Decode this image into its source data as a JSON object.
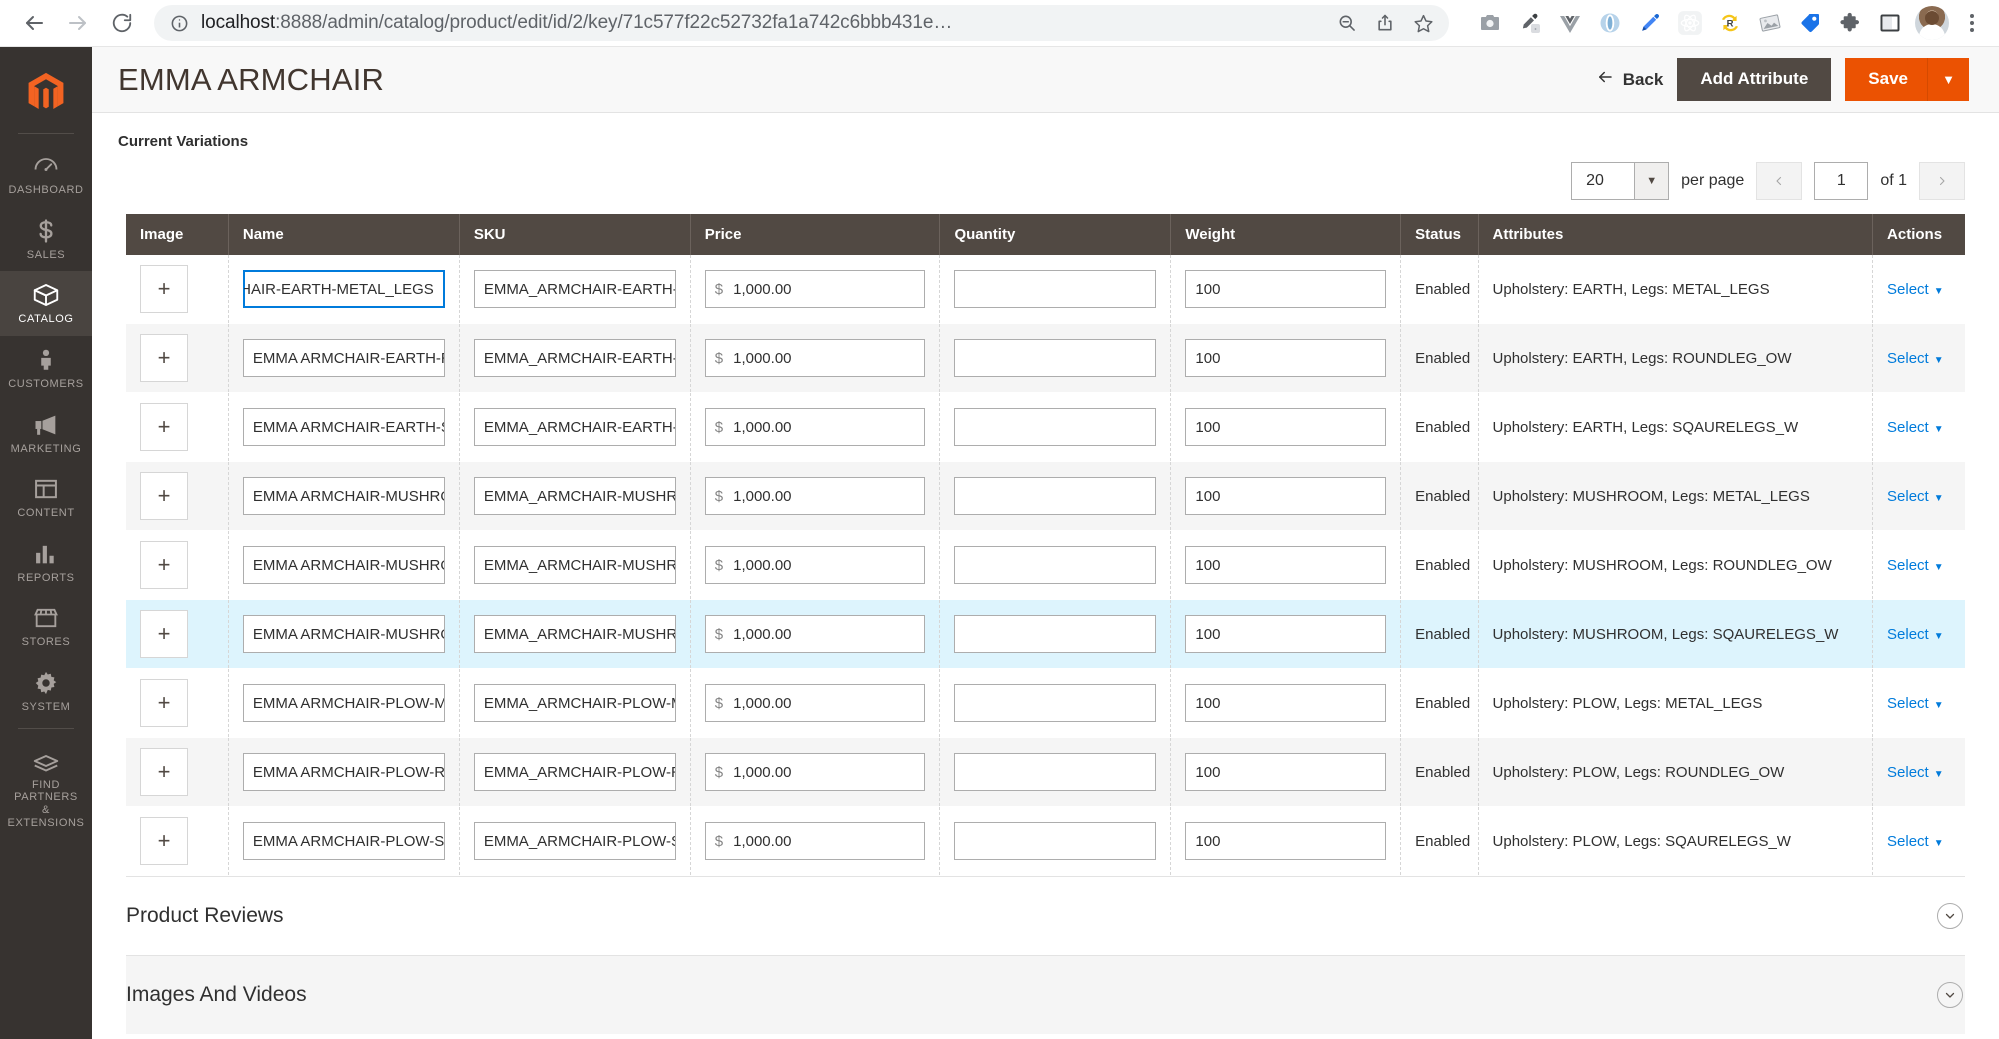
{
  "browser": {
    "back_icon": "arrow-left-icon",
    "forward_icon": "arrow-right-icon",
    "reload_icon": "reload-icon",
    "info_icon": "info-circle-icon",
    "url_host": "localhost",
    "url_rest": ":8888/admin/catalog/product/edit/id/2/key/71c577f22c52732fa1a742c6bbb431e…",
    "url_full": "localhost:8888/admin/catalog/product/edit/id/2/key/71c577f22c52732fa1a742c6bbb431e…",
    "omni_icons": [
      "zoom-out-icon",
      "share-icon",
      "star-icon"
    ],
    "extensions": [
      "camera-icon",
      "eyedropper-icon",
      "vue-devtools-icon",
      "opera-icon",
      "pen-tool-icon",
      "react-devtools-icon",
      "redux-devtools-icon",
      "image-tool-icon",
      "tag-icon",
      "puzzle-extensions-icon",
      "sidepanel-icon"
    ],
    "avatar": "user-avatar",
    "menu_icon": "kebab-menu-icon"
  },
  "sidebar": {
    "logo": "magento-logo",
    "items": [
      {
        "label": "Dashboard",
        "icon": "dashboard-icon",
        "active": false
      },
      {
        "label": "Sales",
        "icon": "dollar-icon",
        "active": false
      },
      {
        "label": "Catalog",
        "icon": "box-icon",
        "active": true
      },
      {
        "label": "Customers",
        "icon": "person-icon",
        "active": false
      },
      {
        "label": "Marketing",
        "icon": "megaphone-icon",
        "active": false
      },
      {
        "label": "Content",
        "icon": "layout-icon",
        "active": false
      },
      {
        "label": "Reports",
        "icon": "bar-chart-icon",
        "active": false
      },
      {
        "label": "Stores",
        "icon": "storefront-icon",
        "active": false
      },
      {
        "label": "System",
        "icon": "gear-icon",
        "active": false
      },
      {
        "label": "Find Partners\n& Extensions",
        "icon": "partners-icon",
        "active": false
      }
    ],
    "find_partners_line1": "Find Partners",
    "find_partners_line2": "& Extensions"
  },
  "header": {
    "title": "EMMA ARMCHAIR",
    "back_label": "Back",
    "back_icon": "arrow-left-icon",
    "add_attribute_label": "Add Attribute",
    "save_label": "Save",
    "save_dropdown_icon": "caret-down-icon"
  },
  "variations": {
    "section_label": "Current Variations",
    "pagination": {
      "per_page_value": "20",
      "per_page_label": "per page",
      "prev_icon": "chevron-left-icon",
      "next_icon": "chevron-right-icon",
      "page_value": "1",
      "of_label": "of 1"
    },
    "columns": [
      "Image",
      "Name",
      "SKU",
      "Price",
      "Quantity",
      "Weight",
      "Status",
      "Attributes",
      "Actions"
    ],
    "add_image_icon": "plus-icon",
    "price_symbol": "$",
    "action_label": "Select",
    "action_caret": "caret-down-icon",
    "rows": [
      {
        "name": "MCHAIR-EARTH-METAL_LEGS",
        "name_focused": true,
        "sku": "EMMA_ARMCHAIR-EARTH-M",
        "price": "1,000.00",
        "quantity": "",
        "weight": "100",
        "status": "Enabled",
        "attributes": "Upholstery: EARTH, Legs: METAL_LEGS",
        "action": "Select"
      },
      {
        "name": "EMMA ARMCHAIR-EARTH-RO",
        "name_focused": false,
        "sku": "EMMA_ARMCHAIR-EARTH-R",
        "price": "1,000.00",
        "quantity": "",
        "weight": "100",
        "status": "Enabled",
        "attributes": "Upholstery: EARTH, Legs: ROUNDLEG_OW",
        "action": "Select"
      },
      {
        "name": "EMMA ARMCHAIR-EARTH-SQ",
        "name_focused": false,
        "sku": "EMMA_ARMCHAIR-EARTH-SQ",
        "price": "1,000.00",
        "quantity": "",
        "weight": "100",
        "status": "Enabled",
        "attributes": "Upholstery: EARTH, Legs: SQAURELEGS_W",
        "action": "Select"
      },
      {
        "name": "EMMA ARMCHAIR-MUSHROO",
        "name_focused": false,
        "sku": "EMMA_ARMCHAIR-MUSHROO",
        "price": "1,000.00",
        "quantity": "",
        "weight": "100",
        "status": "Enabled",
        "attributes": "Upholstery: MUSHROOM, Legs: METAL_LEGS",
        "action": "Select"
      },
      {
        "name": "EMMA ARMCHAIR-MUSHROO",
        "name_focused": false,
        "sku": "EMMA_ARMCHAIR-MUSHROO",
        "price": "1,000.00",
        "quantity": "",
        "weight": "100",
        "status": "Enabled",
        "attributes": "Upholstery: MUSHROOM, Legs: ROUNDLEG_OW",
        "action": "Select"
      },
      {
        "name": "EMMA ARMCHAIR-MUSHROO",
        "name_focused": false,
        "sku": "EMMA_ARMCHAIR-MUSHROO",
        "price": "1,000.00",
        "quantity": "",
        "weight": "100",
        "status": "Enabled",
        "attributes": "Upholstery: MUSHROOM, Legs: SQAURELEGS_W",
        "action": "Select"
      },
      {
        "name": "EMMA ARMCHAIR-PLOW-ME",
        "name_focused": false,
        "sku": "EMMA_ARMCHAIR-PLOW-M",
        "price": "1,000.00",
        "quantity": "",
        "weight": "100",
        "status": "Enabled",
        "attributes": "Upholstery: PLOW, Legs: METAL_LEGS",
        "action": "Select"
      },
      {
        "name": "EMMA ARMCHAIR-PLOW-RO",
        "name_focused": false,
        "sku": "EMMA_ARMCHAIR-PLOW-RO",
        "price": "1,000.00",
        "quantity": "",
        "weight": "100",
        "status": "Enabled",
        "attributes": "Upholstery: PLOW, Legs: ROUNDLEG_OW",
        "action": "Select"
      },
      {
        "name": "EMMA ARMCHAIR-PLOW-SQ",
        "name_focused": false,
        "sku": "EMMA_ARMCHAIR-PLOW-SQ",
        "price": "1,000.00",
        "quantity": "",
        "weight": "100",
        "status": "Enabled",
        "attributes": "Upholstery: PLOW, Legs: SQAURELEGS_W",
        "action": "Select"
      }
    ]
  },
  "sections": [
    {
      "title": "Product Reviews",
      "icon": "chevron-down-icon"
    },
    {
      "title": "Images And Videos",
      "icon": "chevron-down-icon"
    }
  ],
  "colors": {
    "magento_orange": "#eb5202",
    "sidebar_bg": "#373330",
    "table_header_bg": "#514943",
    "link_blue": "#007bdb",
    "row_hover": "#ddf4fd"
  }
}
